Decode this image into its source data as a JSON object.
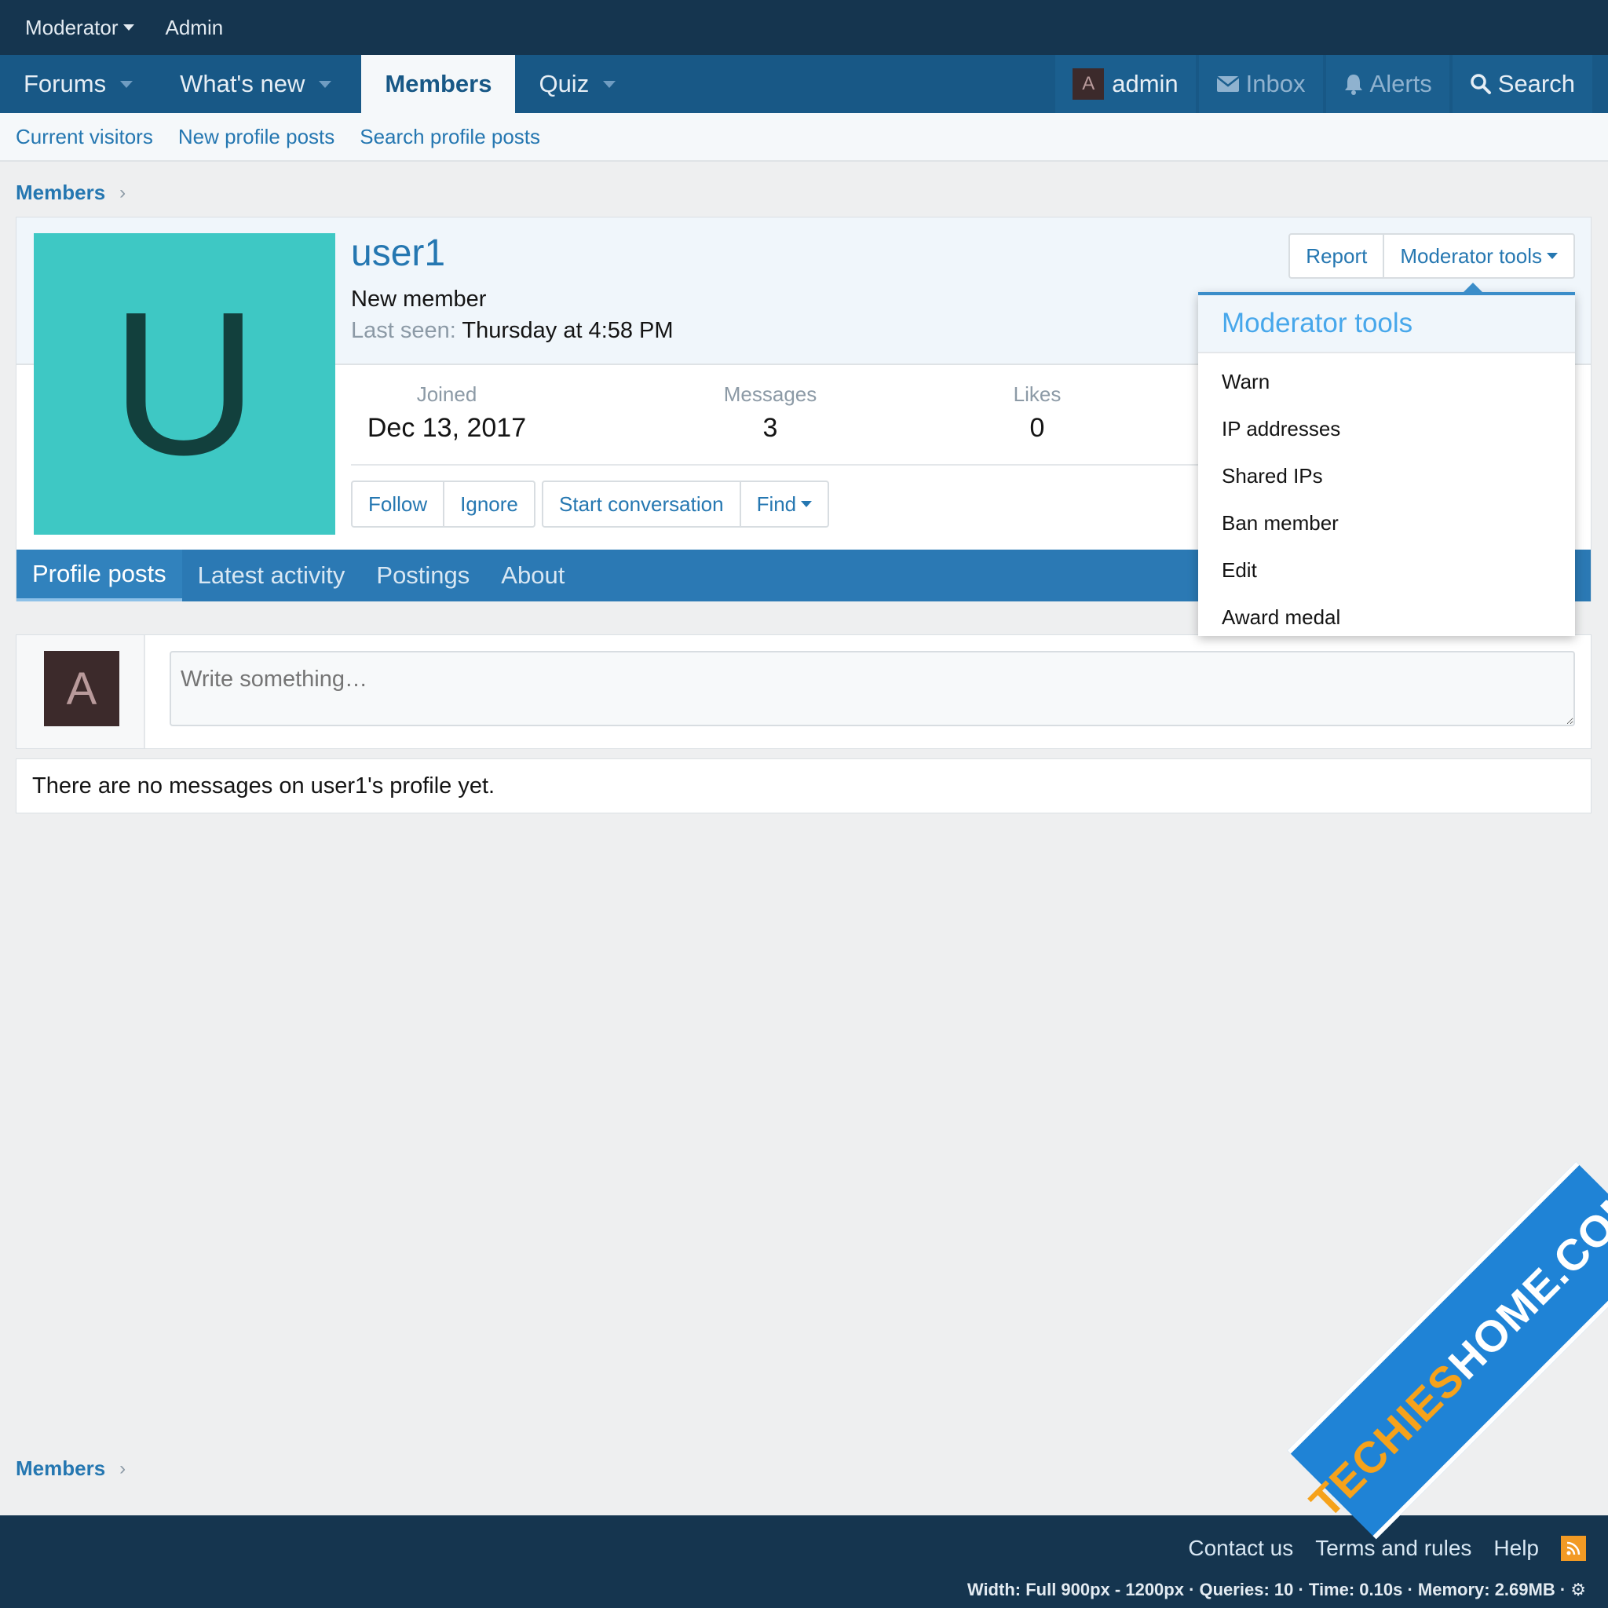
{
  "top_bar": {
    "moderator": "Moderator",
    "admin": "Admin"
  },
  "nav": {
    "tabs": [
      {
        "label": "Forums"
      },
      {
        "label": "What's new"
      },
      {
        "label": "Members"
      },
      {
        "label": "Quiz"
      }
    ],
    "account": {
      "avatar_letter": "A",
      "name": "admin"
    },
    "inbox": "Inbox",
    "alerts": "Alerts",
    "search": "Search"
  },
  "sub_nav": [
    "Current visitors",
    "New profile posts",
    "Search profile posts"
  ],
  "breadcrumb": "Members",
  "profile": {
    "avatar_letter": "U",
    "username": "user1",
    "user_title": "New member",
    "last_seen_label": "Last seen:",
    "last_seen_value": "Thursday at 4:58 PM",
    "stats": [
      {
        "label": "Joined",
        "value": "Dec 13, 2017"
      },
      {
        "label": "Messages",
        "value": "3"
      },
      {
        "label": "Likes",
        "value": "0"
      }
    ],
    "actions": {
      "follow": "Follow",
      "ignore": "Ignore",
      "start_conversation": "Start conversation",
      "find": "Find"
    },
    "top_actions": {
      "report": "Report",
      "moderator_tools": "Moderator tools"
    },
    "tabs": [
      "Profile posts",
      "Latest activity",
      "Postings",
      "About"
    ]
  },
  "moderator_menu": {
    "title": "Moderator tools",
    "items": [
      "Warn",
      "IP addresses",
      "Shared IPs",
      "Ban member",
      "Edit",
      "Award medal"
    ]
  },
  "post_box": {
    "avatar_letter": "A",
    "placeholder": "Write something…"
  },
  "empty_message": "There are no messages on user1's profile yet.",
  "footer": {
    "links": [
      "Contact us",
      "Terms and rules",
      "Help"
    ],
    "debug": "Width: Full 900px - 1200px · Queries: 10 · Time: 0.10s · Memory: 2.69MB · ⚙"
  },
  "watermark": {
    "brand": "TECHIES",
    "rest": "HOME.COM"
  },
  "colors": {
    "header": "#15354f",
    "nav": "#185886",
    "accent": "#2577b1",
    "avatar": "#3ec8c4"
  }
}
